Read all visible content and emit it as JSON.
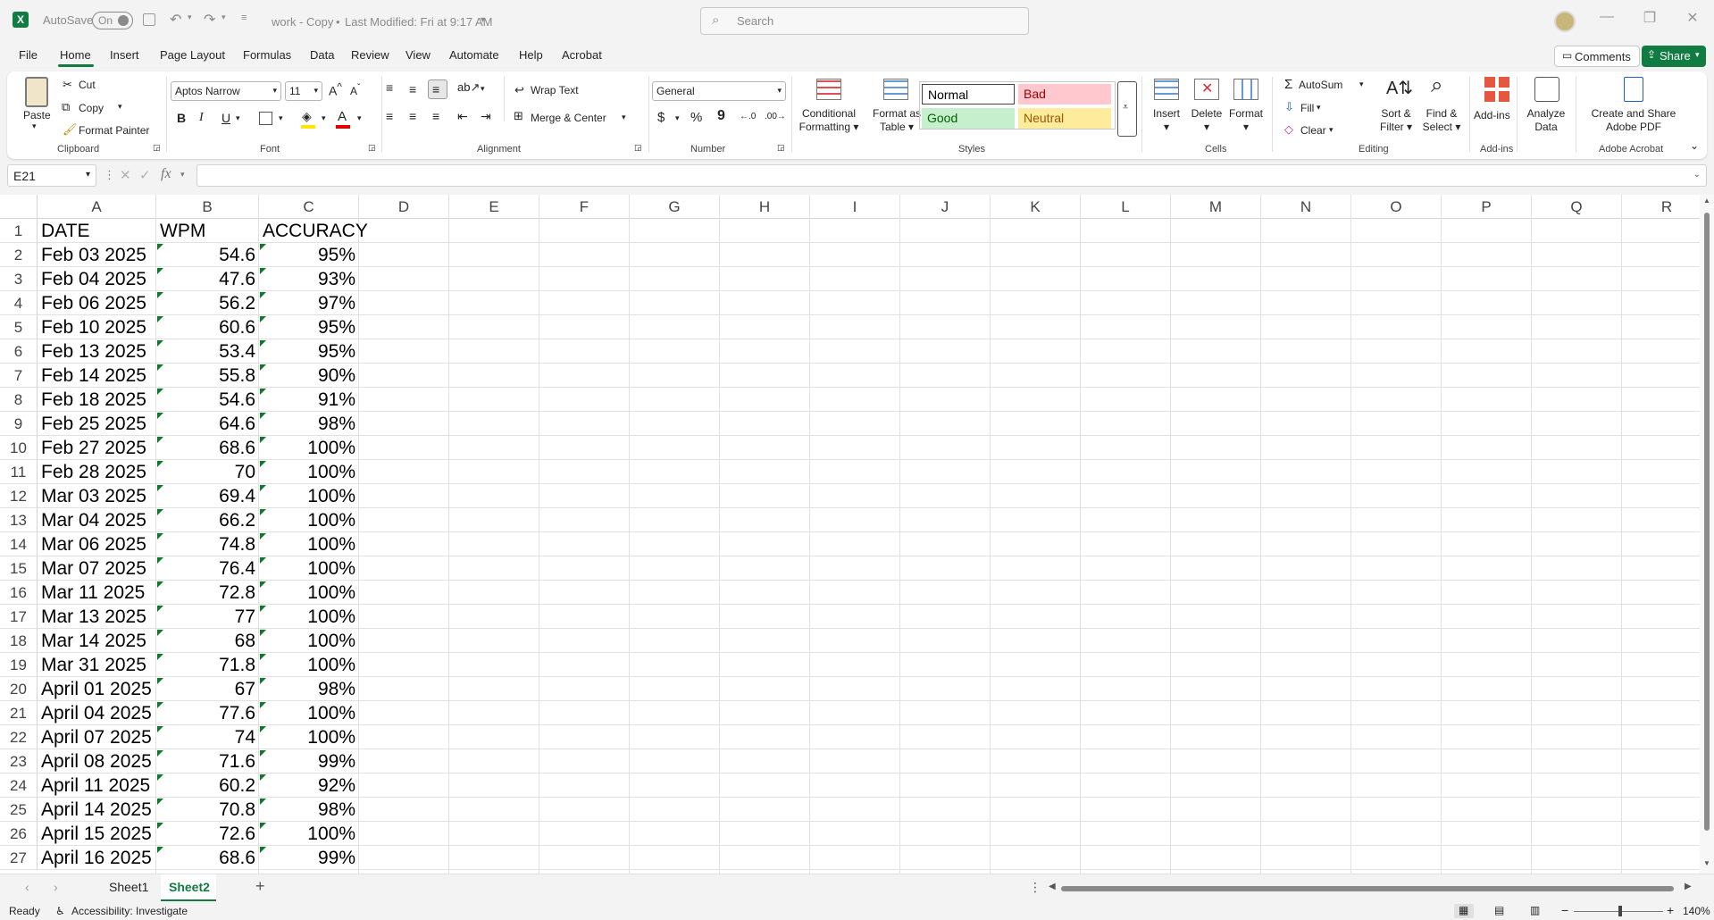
{
  "titlebar": {
    "autosave_label": "AutoSave",
    "autosave_state": "On",
    "doc_title": "work - Copy",
    "separator": "•",
    "last_modified": "Last Modified: Fri at 9:17 AM",
    "search_placeholder": "Search"
  },
  "menu": {
    "tabs": [
      "File",
      "Home",
      "Insert",
      "Page Layout",
      "Formulas",
      "Data",
      "Review",
      "View",
      "Automate",
      "Help",
      "Acrobat"
    ],
    "active": "Home",
    "comments_label": "Comments",
    "share_label": "Share"
  },
  "ribbon": {
    "clipboard": {
      "paste": "Paste",
      "cut": "Cut",
      "copy": "Copy",
      "format_painter": "Format Painter",
      "label": "Clipboard"
    },
    "font": {
      "font_name": "Aptos Narrow",
      "font_size": "11",
      "bold": "B",
      "italic": "I",
      "underline": "U",
      "label": "Font"
    },
    "alignment": {
      "wrap_text": "Wrap Text",
      "merge_center": "Merge & Center",
      "label": "Alignment"
    },
    "number": {
      "format": "General",
      "currency": "$",
      "percent": "%",
      "comma": "9",
      "label": "Number"
    },
    "styles": {
      "conditional_formatting": [
        "Conditional",
        "Formatting"
      ],
      "format_as_table": [
        "Format as",
        "Table"
      ],
      "normal": "Normal",
      "bad": "Bad",
      "good": "Good",
      "neutral": "Neutral",
      "label": "Styles"
    },
    "cells": {
      "insert": "Insert",
      "delete": "Delete",
      "format": "Format",
      "label": "Cells"
    },
    "editing": {
      "autosum": "AutoSum",
      "fill": "Fill",
      "clear": "Clear",
      "sort_filter": [
        "Sort &",
        "Filter"
      ],
      "find_select": [
        "Find &",
        "Select"
      ],
      "label": "Editing"
    },
    "addins": {
      "addins": "Add-ins",
      "label": "Add-ins"
    },
    "analyze": [
      "Analyze",
      "Data"
    ],
    "acrobat": {
      "create_share": [
        "Create and Share",
        "Adobe PDF"
      ],
      "label": "Adobe Acrobat"
    }
  },
  "formula_bar": {
    "name_box": "E21",
    "fx": "fx",
    "formula": ""
  },
  "grid": {
    "columns": [
      "A",
      "B",
      "C",
      "D",
      "E",
      "F",
      "G",
      "H",
      "I",
      "J",
      "K",
      "L",
      "M",
      "N",
      "O",
      "P",
      "Q",
      "R"
    ],
    "rows": [
      {
        "n": "1",
        "a": "DATE",
        "b": "WPM",
        "c": "ACCURACY"
      },
      {
        "n": "2",
        "a": "Feb 03 2025",
        "b": "54.6",
        "c": "95%"
      },
      {
        "n": "3",
        "a": "Feb 04 2025",
        "b": "47.6",
        "c": "93%"
      },
      {
        "n": "4",
        "a": "Feb 06 2025",
        "b": "56.2",
        "c": "97%"
      },
      {
        "n": "5",
        "a": "Feb 10 2025",
        "b": "60.6",
        "c": "95%"
      },
      {
        "n": "6",
        "a": "Feb 13 2025",
        "b": "53.4",
        "c": "95%"
      },
      {
        "n": "7",
        "a": "Feb 14 2025",
        "b": "55.8",
        "c": "90%"
      },
      {
        "n": "8",
        "a": "Feb 18 2025",
        "b": "54.6",
        "c": "91%"
      },
      {
        "n": "9",
        "a": "Feb 25 2025",
        "b": "64.6",
        "c": "98%"
      },
      {
        "n": "10",
        "a": "Feb 27 2025",
        "b": "68.6",
        "c": "100%"
      },
      {
        "n": "11",
        "a": "Feb 28 2025",
        "b": "70",
        "c": "100%"
      },
      {
        "n": "12",
        "a": "Mar 03 2025",
        "b": "69.4",
        "c": "100%"
      },
      {
        "n": "13",
        "a": "Mar 04 2025",
        "b": "66.2",
        "c": "100%"
      },
      {
        "n": "14",
        "a": "Mar 06 2025",
        "b": "74.8",
        "c": "100%"
      },
      {
        "n": "15",
        "a": "Mar 07 2025",
        "b": "76.4",
        "c": "100%"
      },
      {
        "n": "16",
        "a": "Mar 11 2025",
        "b": "72.8",
        "c": "100%"
      },
      {
        "n": "17",
        "a": "Mar 13 2025",
        "b": "77",
        "c": "100%"
      },
      {
        "n": "18",
        "a": "Mar 14 2025",
        "b": "68",
        "c": "100%"
      },
      {
        "n": "19",
        "a": "Mar 31 2025",
        "b": "71.8",
        "c": "100%"
      },
      {
        "n": "20",
        "a": "April 01 2025",
        "b": "67",
        "c": "98%"
      },
      {
        "n": "21",
        "a": "April 04 2025",
        "b": "77.6",
        "c": "100%"
      },
      {
        "n": "22",
        "a": "April 07 2025",
        "b": "74",
        "c": "100%"
      },
      {
        "n": "23",
        "a": "April 08 2025",
        "b": "71.6",
        "c": "99%"
      },
      {
        "n": "24",
        "a": "April 11 2025",
        "b": "60.2",
        "c": "92%"
      },
      {
        "n": "25",
        "a": "April 14 2025",
        "b": "70.8",
        "c": "98%"
      },
      {
        "n": "26",
        "a": "April 15 2025",
        "b": "72.6",
        "c": "100%"
      },
      {
        "n": "27",
        "a": "April 16 2025",
        "b": "68.6",
        "c": "99%"
      }
    ]
  },
  "sheets": {
    "tabs": [
      "Sheet1",
      "Sheet2"
    ],
    "active": "Sheet2",
    "add": "+"
  },
  "status": {
    "ready": "Ready",
    "accessibility": "Accessibility: Investigate",
    "zoom": "140%"
  },
  "colors": {
    "accent": "#107c41",
    "bad_bg": "#ffc7ce",
    "bad_fg": "#9c0006",
    "good_bg": "#c6efce",
    "good_fg": "#006100",
    "neutral_bg": "#ffeb9c",
    "neutral_fg": "#9c5700"
  }
}
